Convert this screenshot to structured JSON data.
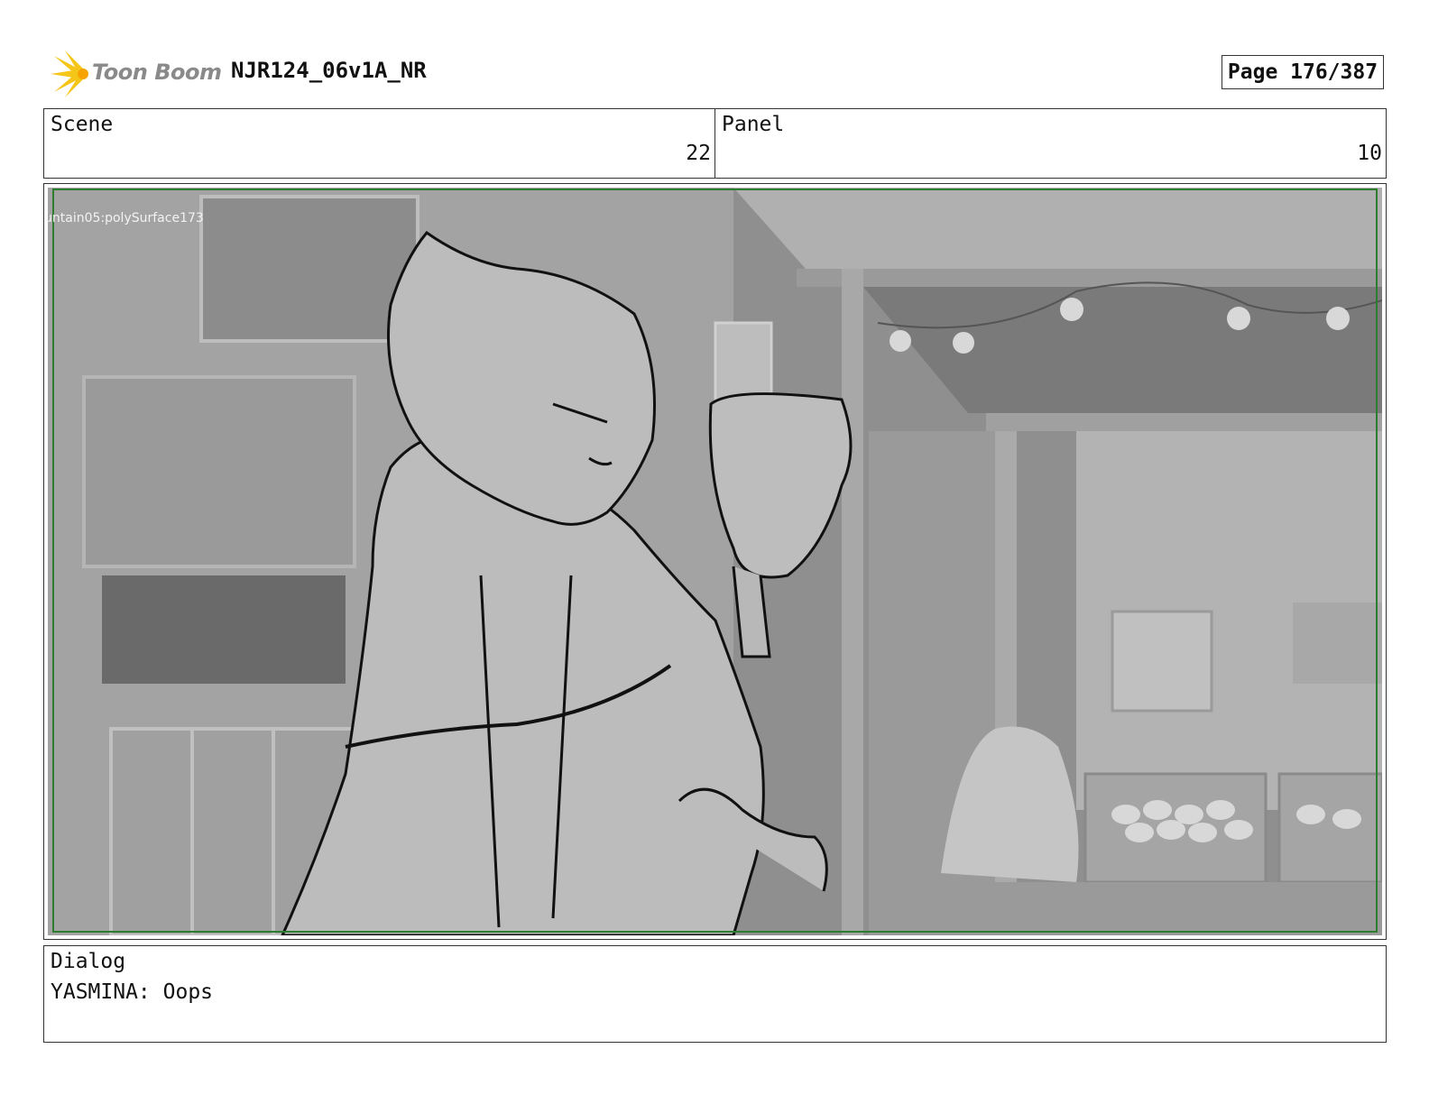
{
  "header": {
    "logo_text": "Toon Boom",
    "doc_title": "NJR124_06v1A_NR",
    "page_label": "Page 176/387"
  },
  "scene": {
    "label": "Scene",
    "value": "22"
  },
  "panel": {
    "label": "Panel",
    "value": "10"
  },
  "frame": {
    "overlay_label": "untain05:polySurface173",
    "safe_area_color": "#2e7d2e"
  },
  "dialog": {
    "label": "Dialog",
    "text": "YASMINA: Oops"
  },
  "colors": {
    "logo_accent": "#f5c518",
    "logo_text": "#8a8a8a",
    "border": "#333333"
  }
}
